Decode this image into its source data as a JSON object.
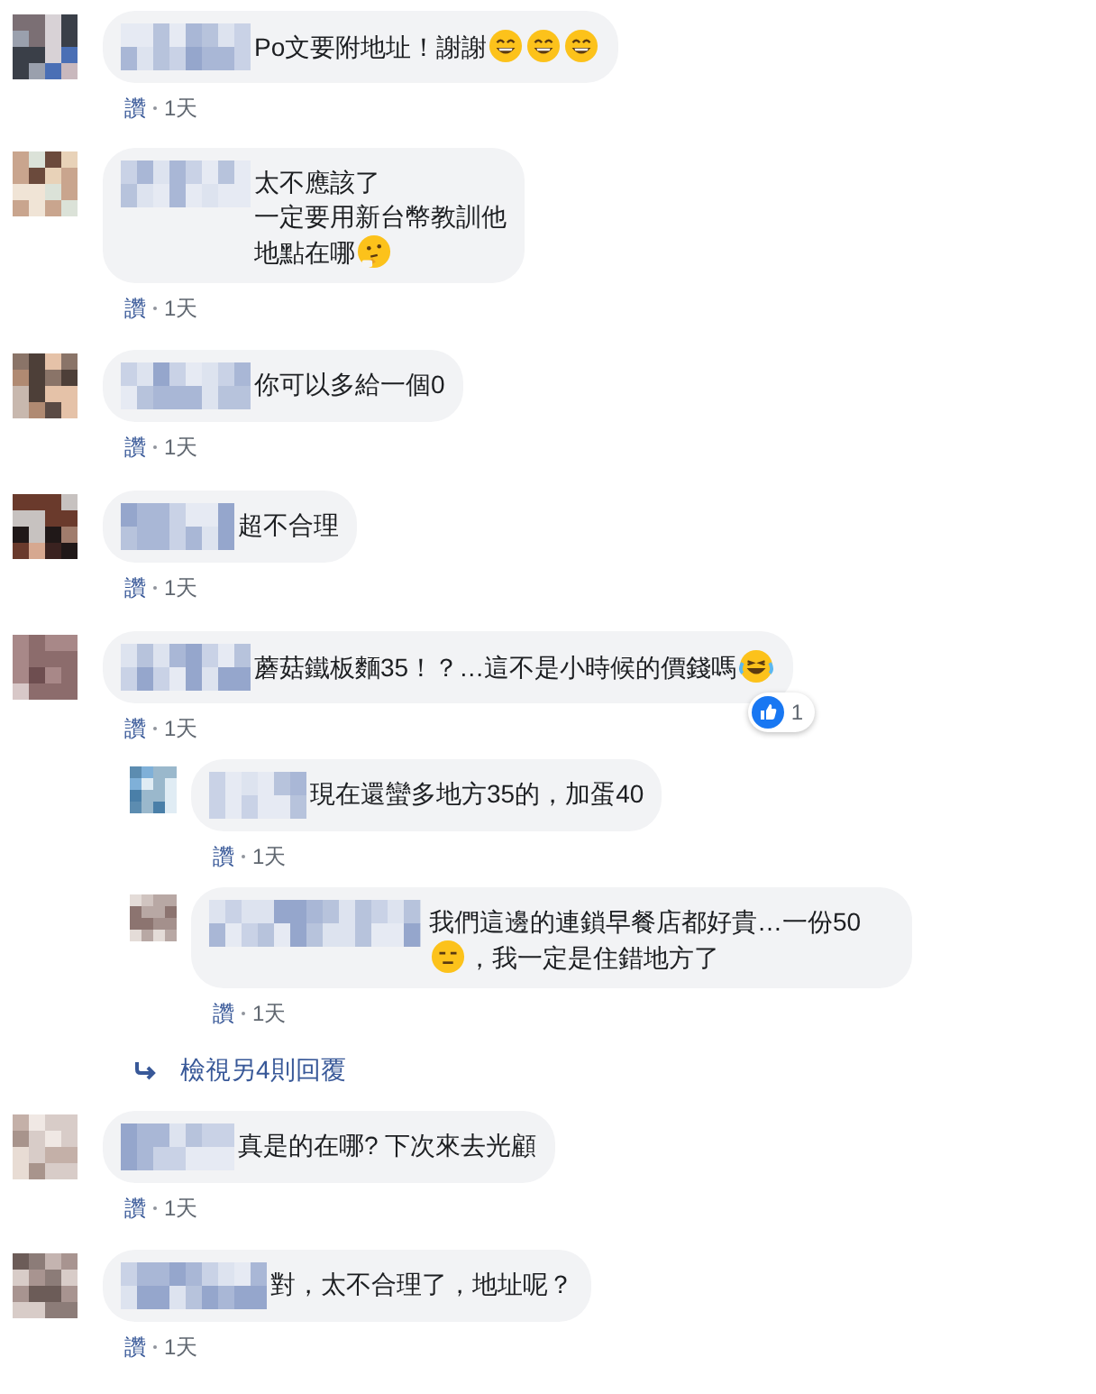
{
  "comments": [
    {
      "segments": [
        {
          "kind": "text",
          "text": "Po文要附地址！謝謝"
        },
        {
          "kind": "grin"
        },
        {
          "kind": "grin"
        },
        {
          "kind": "grin"
        }
      ],
      "like_label": "讚",
      "time": "1天"
    },
    {
      "segments": [
        {
          "kind": "text",
          "text": "太不應該了"
        },
        {
          "kind": "text",
          "text": "一定要用新台幣教訓他",
          "newline": true
        },
        {
          "kind": "text",
          "text": "地點在哪",
          "newline": true
        },
        {
          "kind": "thinking"
        }
      ],
      "like_label": "讚",
      "time": "1天"
    },
    {
      "segments": [
        {
          "kind": "text",
          "text": "你可以多給一個0"
        }
      ],
      "like_label": "讚",
      "time": "1天"
    },
    {
      "segments": [
        {
          "kind": "text",
          "text": "超不合理"
        }
      ],
      "like_label": "讚",
      "time": "1天"
    },
    {
      "segments": [
        {
          "kind": "text",
          "text": "蘑菇鐵板麵35！？…這不是小時候的價錢嗎"
        },
        {
          "kind": "laugh"
        }
      ],
      "like_label": "讚",
      "time": "1天",
      "reaction_count": "1",
      "replies": [
        {
          "segments": [
            {
              "kind": "text",
              "text": "現在還蠻多地方35的，加蛋40"
            }
          ],
          "like_label": "讚",
          "time": "1天"
        },
        {
          "segments": [
            {
              "kind": "text",
              "text": "我們這邊的連鎖早餐店都好貴…一份50"
            },
            {
              "kind": "neutral"
            },
            {
              "kind": "text",
              "text": "，我一定是住錯地方了"
            }
          ],
          "like_label": "讚",
          "time": "1天"
        }
      ],
      "more_replies": "檢視另4則回覆"
    },
    {
      "segments": [
        {
          "kind": "text",
          "text": "真是的在哪? 下次來去光顧"
        }
      ],
      "like_label": "讚",
      "time": "1天"
    },
    {
      "segments": [
        {
          "kind": "text",
          "text": "對，太不合理了，地址呢？"
        }
      ],
      "like_label": "讚",
      "time": "1天"
    }
  ]
}
